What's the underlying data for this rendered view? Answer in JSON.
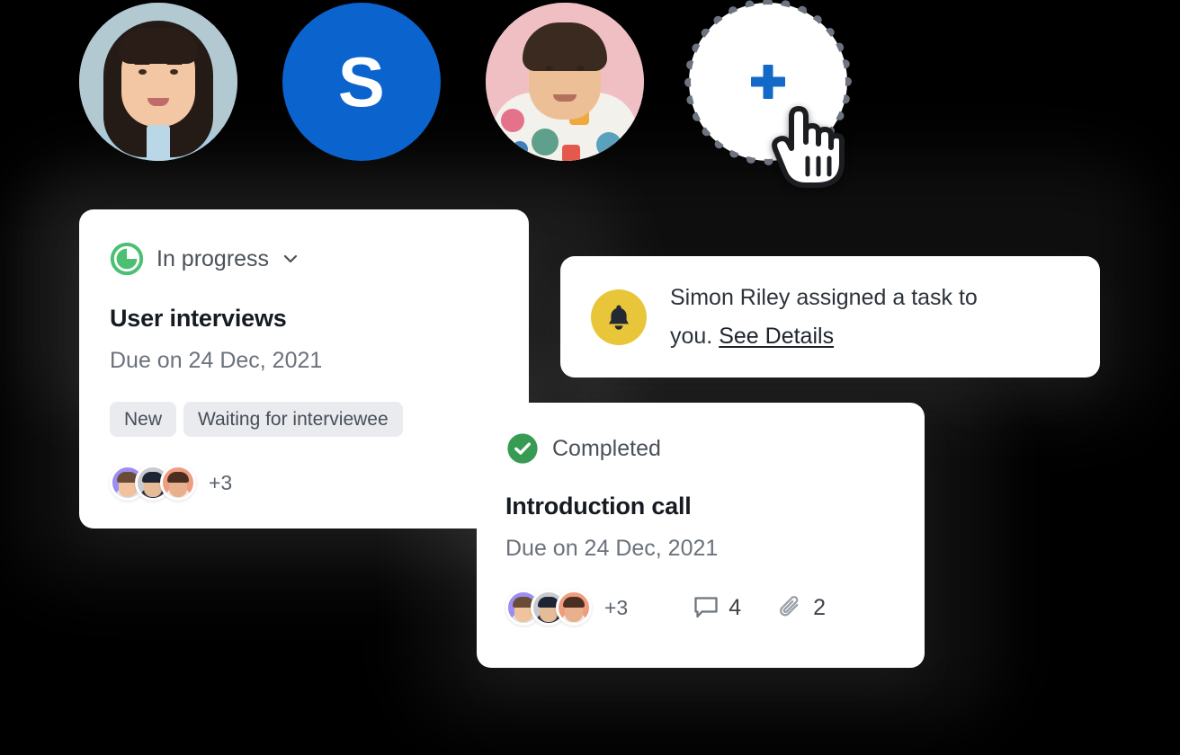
{
  "avatar_row": {
    "members": [
      {
        "name": "member-avatar-photo-1",
        "type": "photo",
        "alt": "Woman with dark hair in blue shirt"
      },
      {
        "name": "member-avatar-initial",
        "type": "initial",
        "initial": "S",
        "color": "#0B63CE"
      },
      {
        "name": "member-avatar-photo-2",
        "type": "photo",
        "alt": "Man in colorful patterned hoodie"
      },
      {
        "name": "add-member-button",
        "type": "add",
        "icon": "plus-icon",
        "color": "#1269C7"
      }
    ],
    "cursor": "pointer-hand-cursor"
  },
  "task_card_1": {
    "status": {
      "label": "In progress",
      "icon": "progress-pie-icon",
      "color": "#4CC072"
    },
    "chevron_icon": "chevron-down-icon",
    "title": "User interviews",
    "due": "Due on 24 Dec, 2021",
    "tags": [
      "New",
      "Waiting for interviewee"
    ],
    "assignees": {
      "avatars": 3,
      "overflow": "+3"
    }
  },
  "notification_card": {
    "icon": "bell-icon",
    "icon_bg": "#E9C53A",
    "text": "Simon Riley assigned a task to you.",
    "link": "See Details"
  },
  "task_card_2": {
    "status": {
      "label": "Completed",
      "icon": "check-circle-icon",
      "color": "#389B54"
    },
    "title": "Introduction call",
    "due": "Due on 24 Dec, 2021",
    "assignees": {
      "avatars": 3,
      "overflow": "+3"
    },
    "comments": {
      "icon": "comment-icon",
      "count": "4"
    },
    "attachments": {
      "icon": "paperclip-icon",
      "count": "2"
    }
  }
}
